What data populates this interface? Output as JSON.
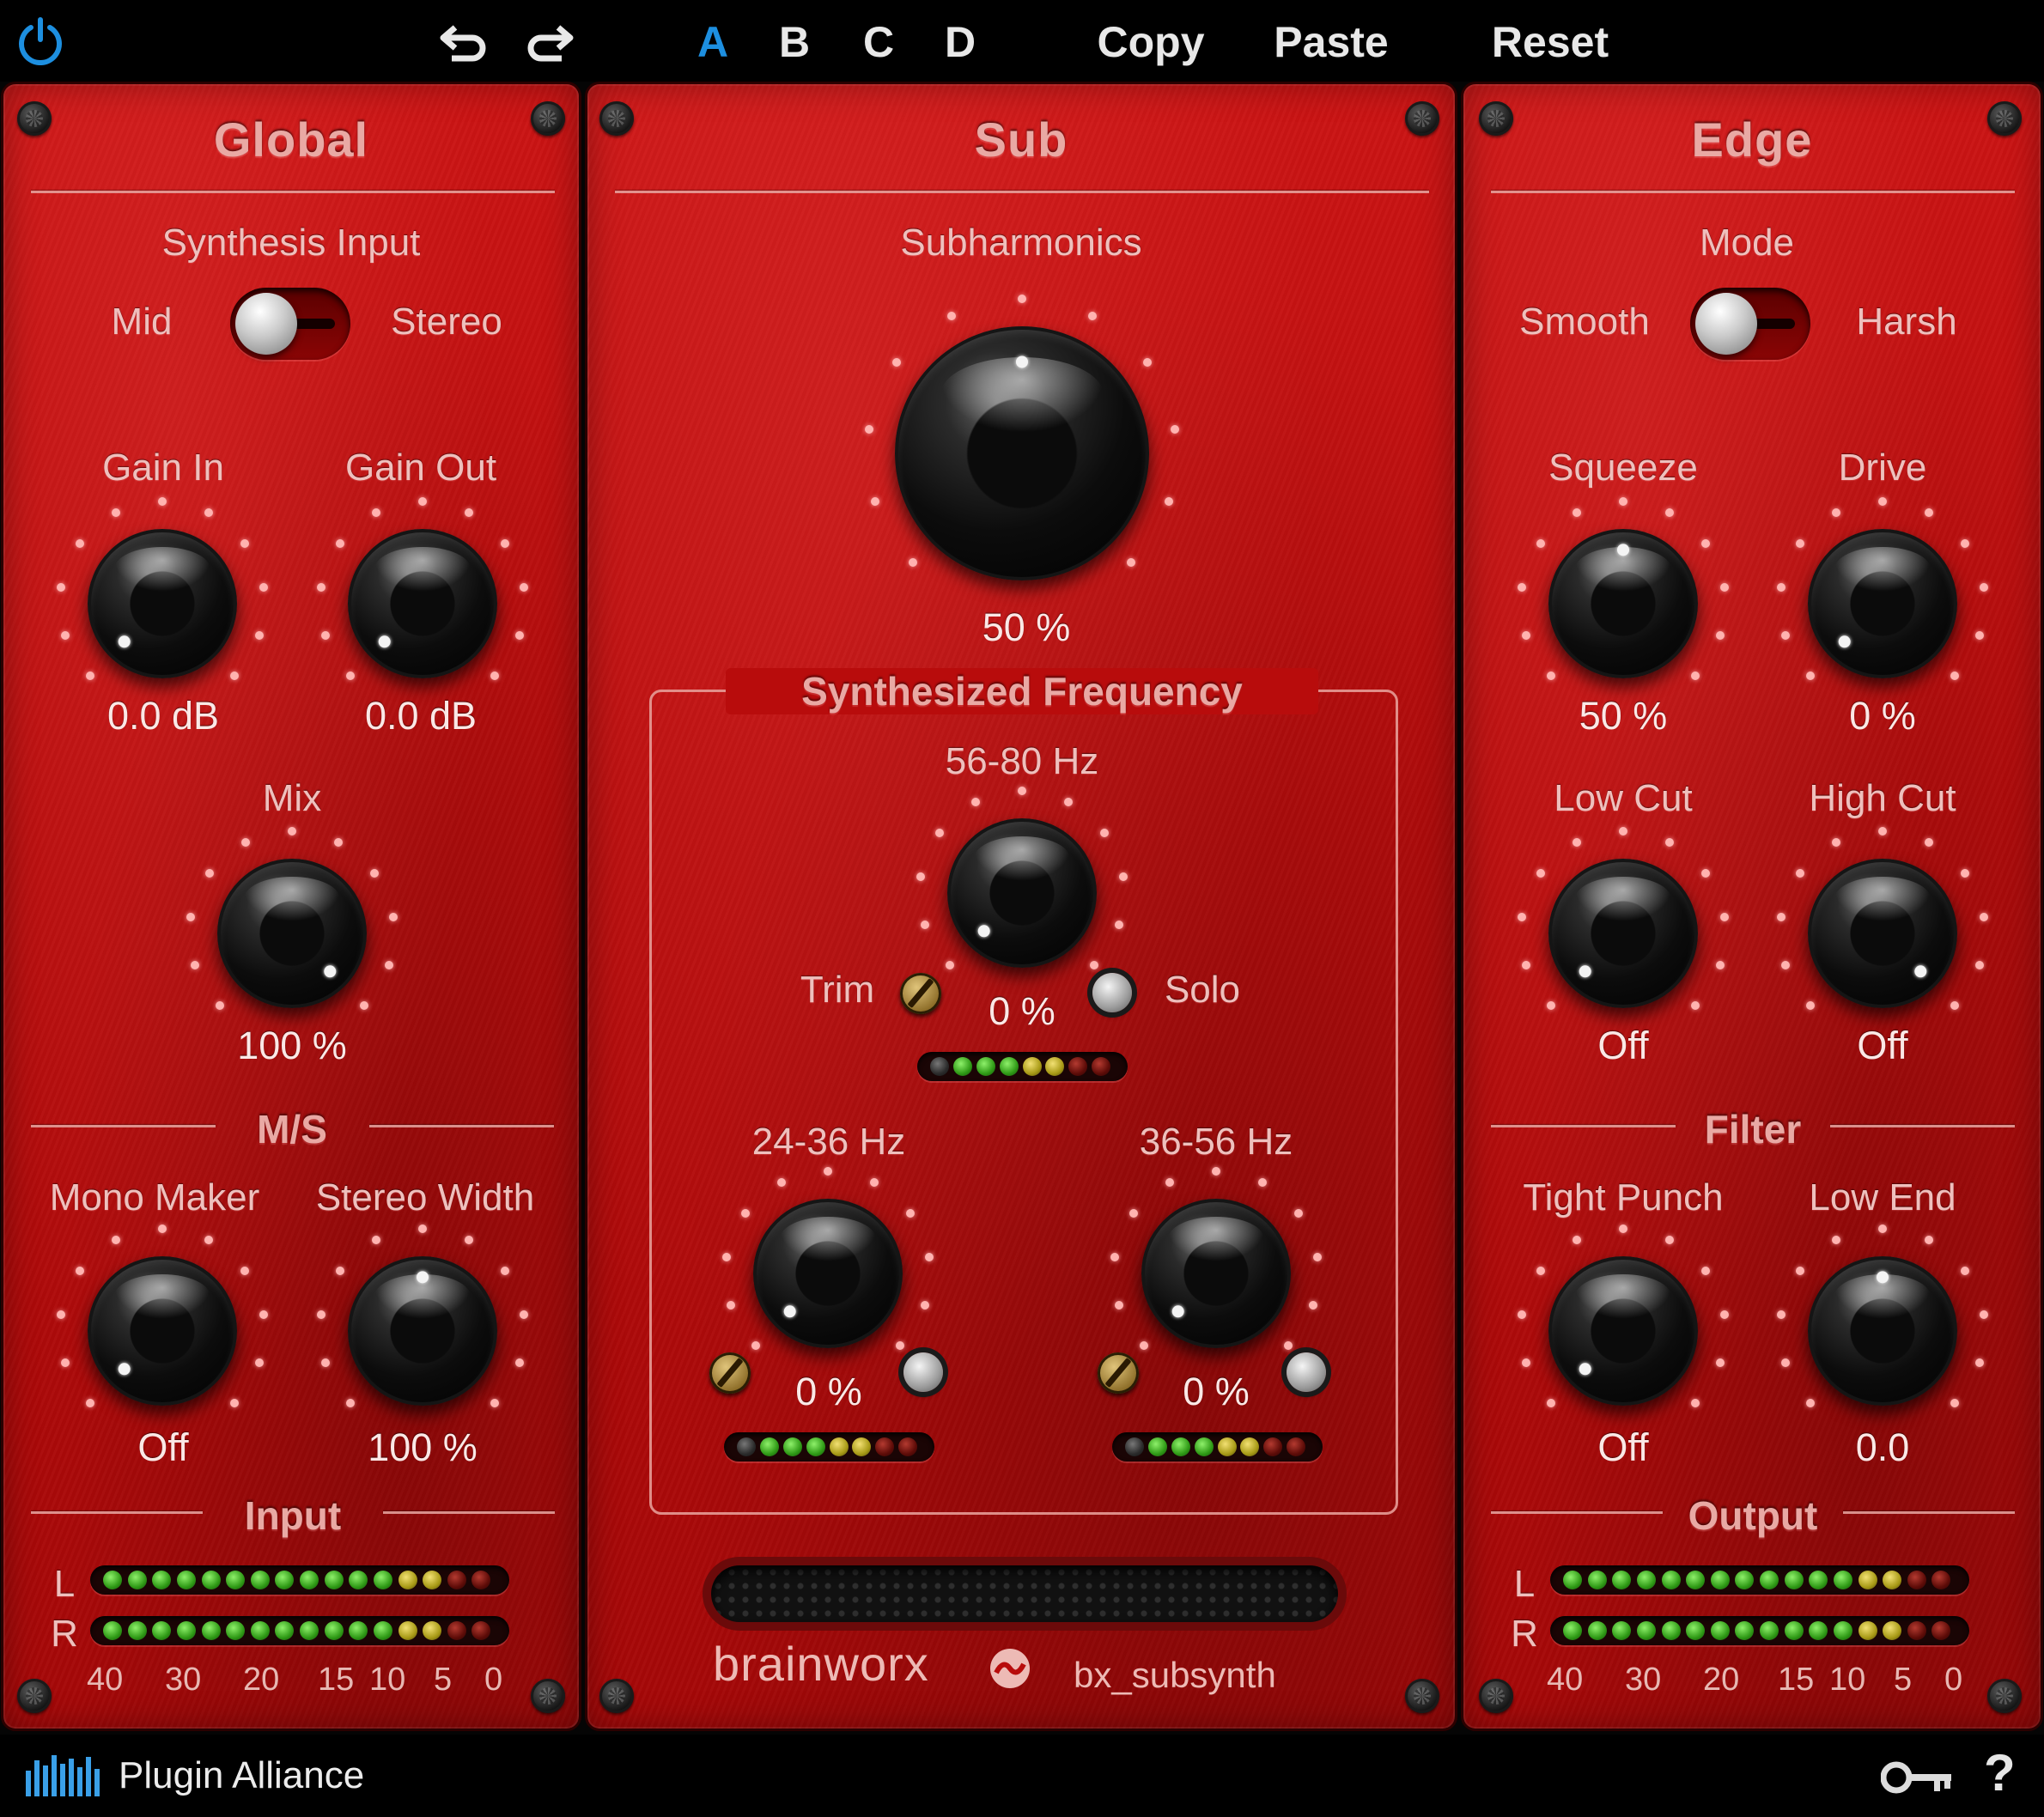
{
  "toolbar": {
    "undo_icon": "undo-icon",
    "redo_icon": "redo-icon",
    "presets": [
      "A",
      "B",
      "C",
      "D"
    ],
    "active_preset": "A",
    "copy": "Copy",
    "paste": "Paste",
    "reset": "Reset",
    "power_icon": "power-icon"
  },
  "global": {
    "title": "Global",
    "synthesis_input": {
      "label": "Synthesis Input",
      "left": "Mid",
      "right": "Stereo"
    },
    "gain_in": {
      "label": "Gain In",
      "value": "0.0 dB"
    },
    "gain_out": {
      "label": "Gain Out",
      "value": "0.0 dB"
    },
    "mix": {
      "label": "Mix",
      "value": "100 %"
    },
    "ms_title": "M/S",
    "mono_maker": {
      "label": "Mono Maker",
      "value": "Off"
    },
    "stereo_width": {
      "label": "Stereo Width",
      "value": "100 %"
    },
    "input_title": "Input",
    "meter_labels": [
      "L",
      "R"
    ],
    "scale": [
      "40",
      "30",
      "20",
      "15",
      "10",
      "5",
      "0"
    ]
  },
  "sub": {
    "title": "Sub",
    "subharmonics": {
      "label": "Subharmonics",
      "value": "50 %"
    },
    "synth_freq_title": "Synthesized Frequency",
    "band_high": {
      "label": "56-80 Hz",
      "value": "0 %",
      "trim": "Trim",
      "solo": "Solo"
    },
    "band_low": {
      "label": "24-36 Hz",
      "value": "0 %"
    },
    "band_mid": {
      "label": "36-56 Hz",
      "value": "0 %"
    },
    "brand": "brainworx",
    "product": "bx_subsynth"
  },
  "edge": {
    "title": "Edge",
    "mode": {
      "label": "Mode",
      "left": "Smooth",
      "right": "Harsh"
    },
    "squeeze": {
      "label": "Squeeze",
      "value": "50 %"
    },
    "drive": {
      "label": "Drive",
      "value": "0 %"
    },
    "low_cut": {
      "label": "Low Cut",
      "value": "Off"
    },
    "high_cut": {
      "label": "High Cut",
      "value": "Off"
    },
    "filter_title": "Filter",
    "tight_punch": {
      "label": "Tight Punch",
      "value": "Off"
    },
    "low_end": {
      "label": "Low End",
      "value": "0.0"
    },
    "output_title": "Output",
    "meter_labels": [
      "L",
      "R"
    ],
    "scale": [
      "40",
      "30",
      "20",
      "15",
      "10",
      "5",
      "0"
    ]
  },
  "footer": {
    "brand": "Plugin Alliance",
    "logo_icon": "plugin-alliance-logo-icon",
    "key_icon": "key-icon",
    "help": "?"
  },
  "colors": {
    "panel": "#b80c0c",
    "active_preset": "#1d8fe0",
    "label": "#efc0bd"
  }
}
